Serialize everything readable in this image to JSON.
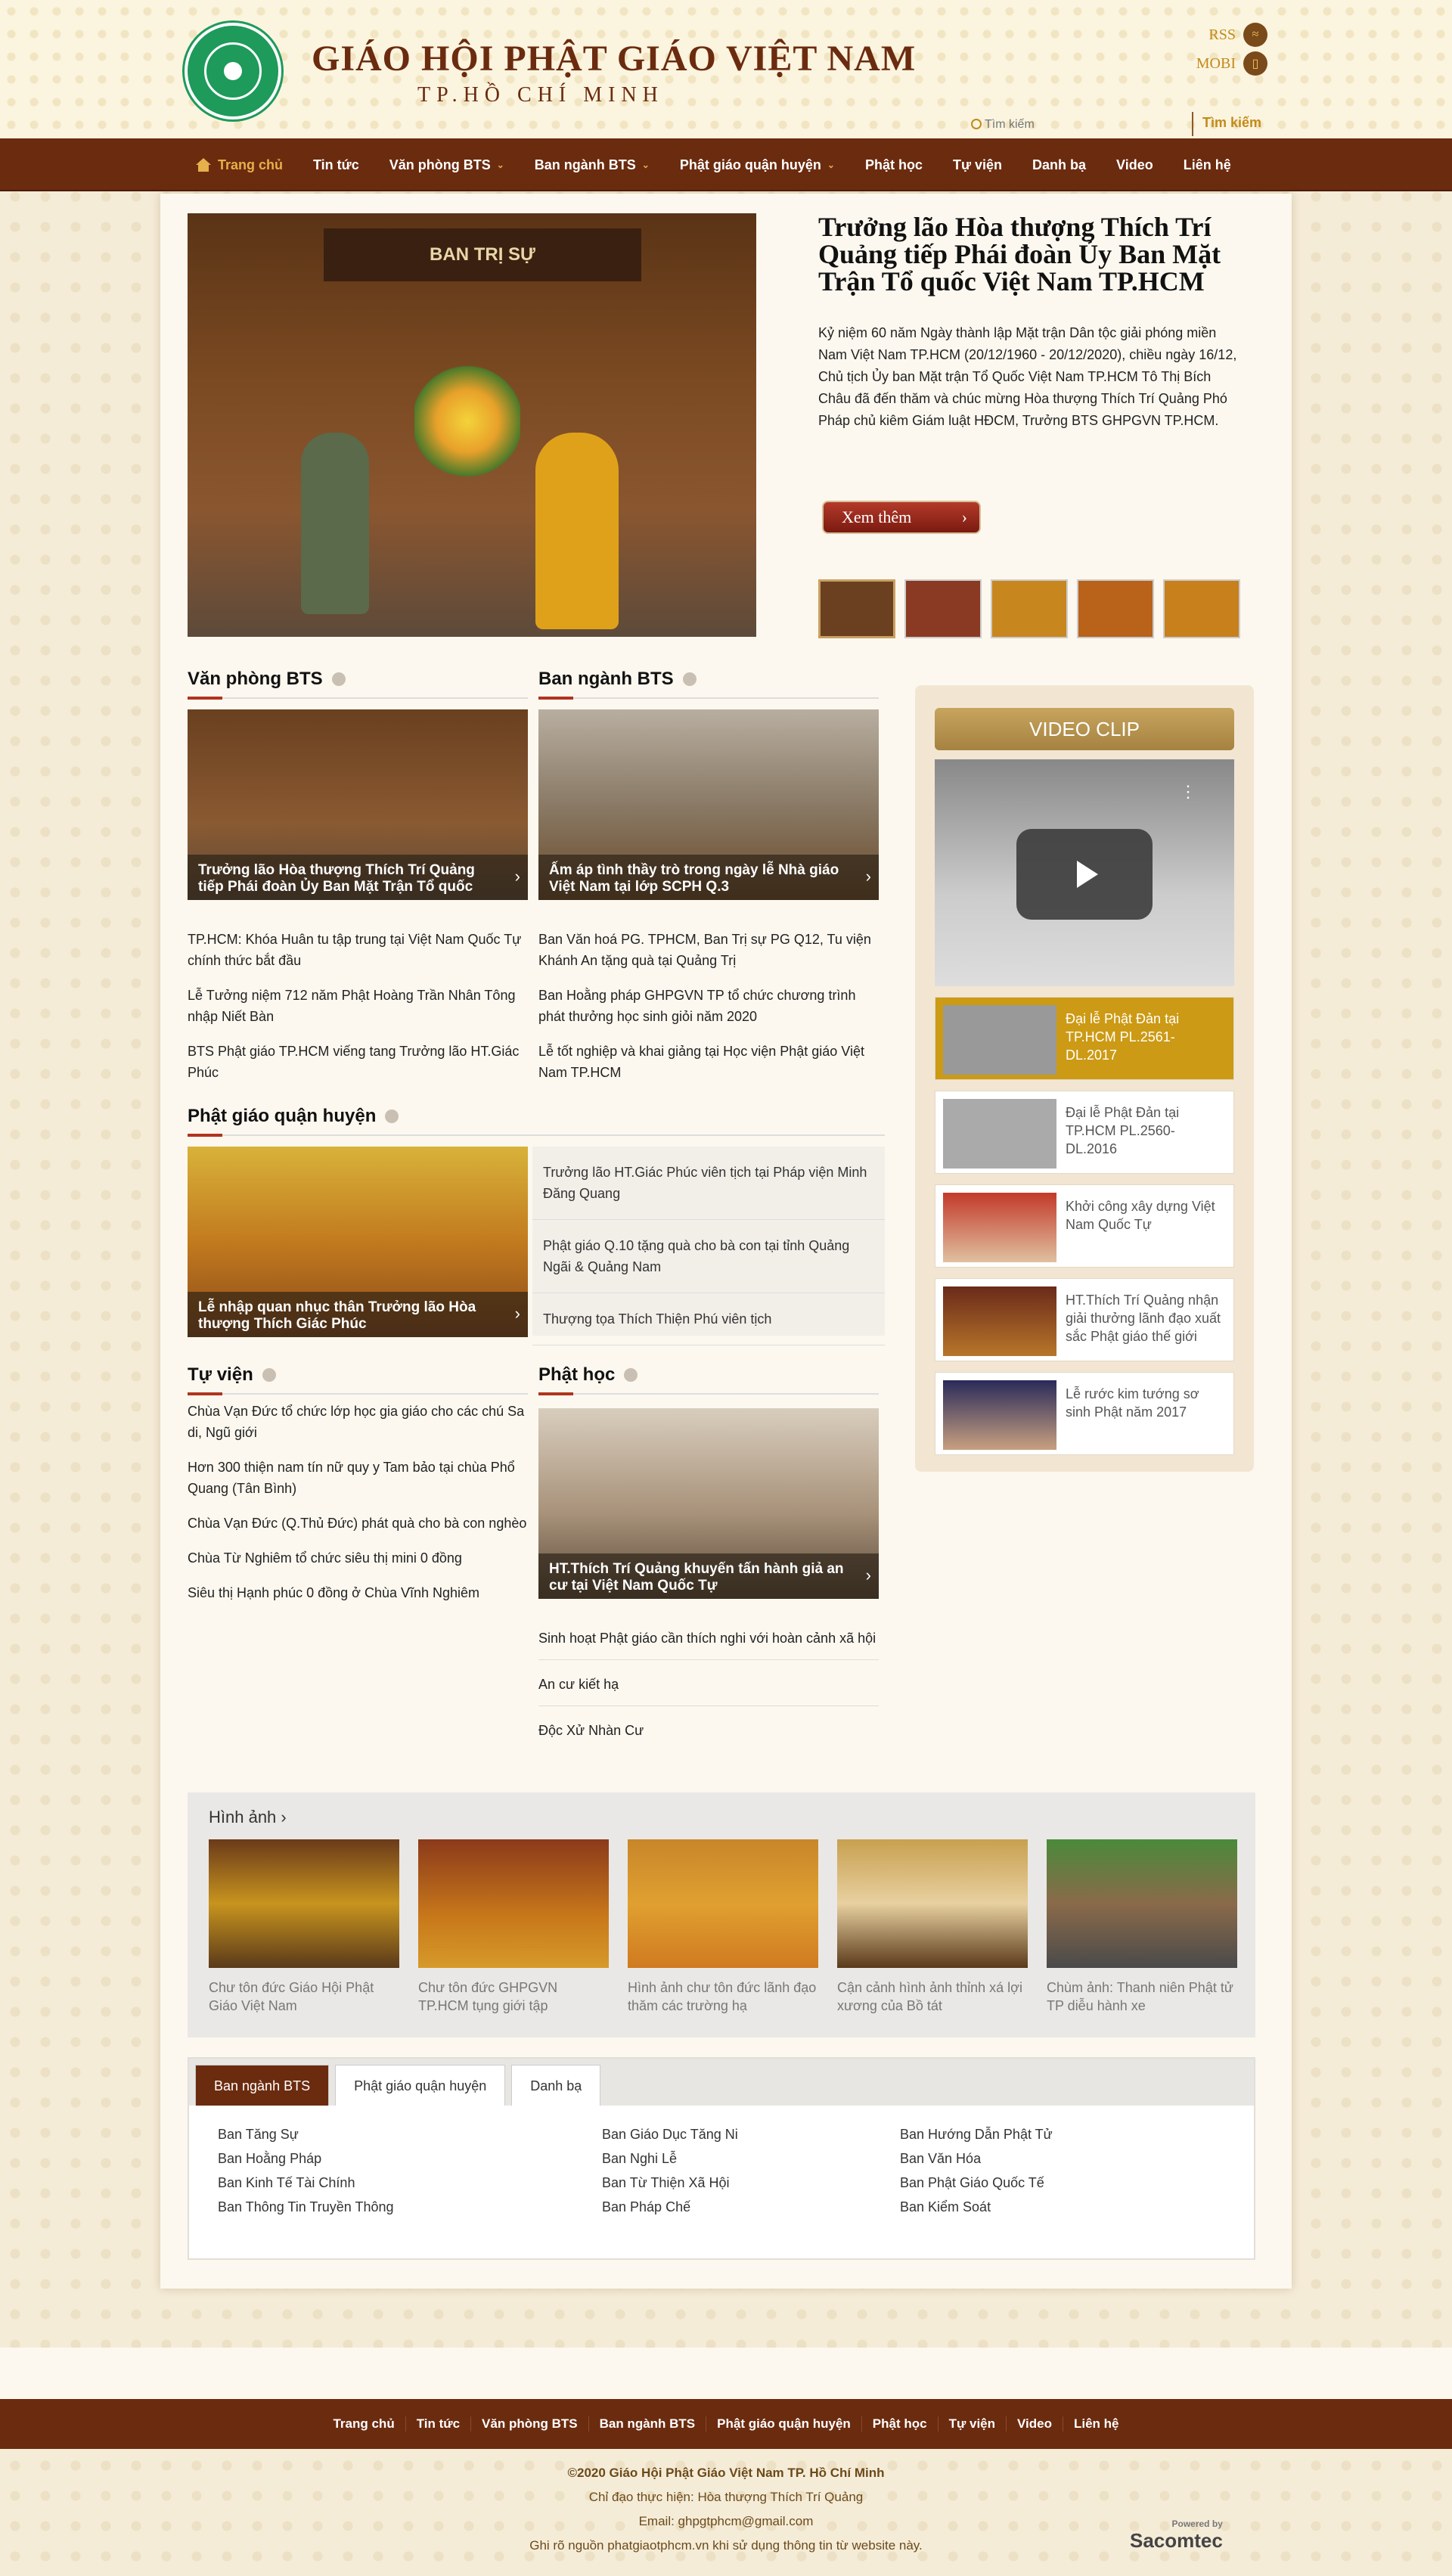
{
  "header": {
    "title": "GIÁO HỘI PHẬT GIÁO VIỆT NAM",
    "subtitle": "TP.HỒ CHÍ MINH",
    "rss": "RSS",
    "mobi": "MOBI",
    "search_placeholder": "Tìm kiếm",
    "search_button": "Tìm kiếm"
  },
  "nav": [
    "Trang chủ",
    "Tin tức",
    "Văn phòng BTS",
    "Ban ngành BTS",
    "Phật giáo quận huyện",
    "Phật học",
    "Tự viện",
    "Danh bạ",
    "Video",
    "Liên hệ"
  ],
  "hero": {
    "title": "Trưởng lão Hòa thượng Thích Trí Quảng tiếp Phái đoàn Ủy Ban Mặt Trận Tổ quốc Việt Nam TP.HCM",
    "desc": "Kỷ niệm 60 năm Ngày thành lập Mặt trận Dân tộc giải phóng miền Nam Việt Nam TP.HCM (20/12/1960 - 20/12/2020), chiều ngày 16/12,  Chủ tịch Ủy ban Mặt trận Tổ Quốc Việt Nam TP.HCM Tô Thị Bích Châu đã đến thăm và chúc mừng Hòa thượng Thích Trí Quảng Phó Pháp chủ kiêm Giám luật HĐCM, Trưởng BTS GHPGVN TP.HCM.",
    "more": "Xem thêm",
    "sign": "BAN TRỊ SỰ"
  },
  "van_phong": {
    "title": "Văn phòng BTS",
    "card": "Trưởng lão Hòa thượng Thích Trí Quảng tiếp Phái đoàn Ủy Ban Mặt Trận Tổ quốc",
    "items": [
      "TP.HCM: Khóa Huân tu tập trung tại Việt Nam Quốc Tự chính thức bắt đầu",
      "Lễ Tưởng niệm 712 năm Phật Hoàng Trần Nhân Tông nhập Niết Bàn",
      "BTS Phật giáo TP.HCM viếng tang Trưởng lão HT.Giác Phúc"
    ]
  },
  "ban_nganh": {
    "title": "Ban ngành BTS",
    "card": "Ấm áp tình thầy trò trong ngày lễ Nhà giáo Việt Nam tại lớp SCPH Q.3",
    "items": [
      "Ban Văn hoá PG. TPHCM, Ban Trị sự PG Q12, Tu viện Khánh An tặng quà tại Quảng Trị",
      "Ban Hoằng pháp GHPGVN TP tổ chức chương trình phát thưởng học sinh giỏi năm 2020",
      "Lễ tốt nghiệp và khai giảng tại Học viện Phật giáo Việt Nam TP.HCM"
    ]
  },
  "quan_huyen": {
    "title": "Phật giáo quận huyện",
    "card": "Lễ nhập quan nhục thân Trưởng lão Hòa thượng Thích Giác Phúc",
    "items": [
      "Trưởng lão HT.Giác Phúc viên tịch tại Pháp viện Minh Đăng Quang",
      "Phật giáo Q.10 tặng quà cho bà con tại tỉnh Quảng Ngãi & Quảng Nam",
      "Thượng tọa Thích Thiện Phú viên tịch"
    ]
  },
  "tu_vien": {
    "title": "Tự viện",
    "items": [
      "Chùa Vạn Đức tổ chức lớp học gia giáo cho các chú Sa di, Ngũ giới",
      "Hơn 300 thiện nam tín nữ quy y Tam bảo tại chùa Phổ Quang (Tân Bình)",
      "Chùa Vạn Đức (Q.Thủ Đức) phát quà cho bà con nghèo",
      "Chùa Từ Nghiêm tổ chức siêu thị mini 0 đồng",
      "Siêu thị Hạnh phúc 0 đồng ở Chùa Vĩnh Nghiêm"
    ]
  },
  "phat_hoc": {
    "title": "Phật học",
    "card": "HT.Thích Trí Quảng khuyến tấn hành giả an cư tại Việt Nam Quốc Tự",
    "items": [
      "Sinh hoạt Phật giáo cần thích nghi với hoàn cảnh xã hội",
      "An cư kiết hạ",
      "Độc Xử Nhàn Cư"
    ]
  },
  "video": {
    "title": "VIDEO CLIP",
    "items": [
      "Đại lễ Phật Đản tại TP.HCM PL.2561-DL.2017",
      "Đại lễ Phật Đản tại TP.HCM PL.2560-DL.2016",
      "Khởi công xây dựng Việt Nam Quốc Tự",
      "HT.Thích Trí Quảng nhận giải thưởng lãnh đạo xuất sắc Phật giáo thế giới",
      "Lễ rước kim tướng sơ sinh Phật năm 2017"
    ]
  },
  "gallery": {
    "title": "Hình ảnh",
    "items": [
      "Chư tôn đức Giáo Hội Phật Giáo Việt Nam",
      "Chư tôn đức GHPGVN TP.HCM tụng giới tập",
      "Hình ảnh chư tôn đức lãnh đạo thăm các trường hạ",
      "Cận cảnh hình ảnh thỉnh xá lợi xương của Bồ tát",
      "Chùm ảnh: Thanh niên Phật tử TP diễu hành xe"
    ]
  },
  "tabs": {
    "labels": [
      "Ban ngành BTS",
      "Phật giáo quận huyện",
      "Danh bạ"
    ],
    "col1": [
      "Ban Tăng Sự",
      "Ban Hoằng Pháp",
      "Ban Kinh Tế Tài Chính",
      "Ban Thông Tin Truyền Thông"
    ],
    "col2": [
      "Ban Giáo Dục Tăng Ni",
      "Ban Nghi Lễ",
      "Ban Từ Thiện Xã Hội",
      "Ban Pháp Chế"
    ],
    "col3": [
      "Ban Hướng Dẫn Phật Tử",
      "Ban Văn Hóa",
      "Ban Phật Giáo Quốc Tế",
      "Ban Kiểm Soát"
    ]
  },
  "footer": {
    "nav": [
      "Trang chủ",
      "Tin tức",
      "Văn phòng BTS",
      "Ban ngành BTS",
      "Phật giáo quận huyện",
      "Phật học",
      "Tự viện",
      "Video",
      "Liên hệ"
    ],
    "copyright": "©2020 Giáo Hội Phật Giáo Việt Nam TP. Hồ Chí Minh",
    "director": "Chỉ đạo thực hiện: Hòa thượng Thích Trí Quảng",
    "email": "Email:   ghpgtphcm@gmail.com",
    "note": "Ghi rõ nguồn phatgiaotphcm.vn khi sử dụng thông tin từ website này.",
    "sponsor_small": "Powered by",
    "sponsor": "Sacomtec"
  },
  "colors": {
    "brand": "#6b2b0f",
    "accent": "#c28a1a",
    "video_active": "#cc9a14"
  }
}
